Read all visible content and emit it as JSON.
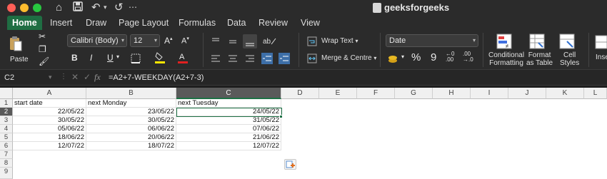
{
  "window": {
    "title": "geeksforgeeks"
  },
  "ribbon_tabs": [
    "Home",
    "Insert",
    "Draw",
    "Page Layout",
    "Formulas",
    "Data",
    "Review",
    "View"
  ],
  "ribbon": {
    "paste_label": "Paste",
    "font_name": "Calibri (Body)",
    "font_size": "12",
    "bold": "B",
    "italic": "I",
    "underline": "U",
    "wrap_text": "Wrap Text",
    "merge_centre": "Merge & Centre",
    "number_format": "Date",
    "percent": "%",
    "comma": "9",
    "conditional_formatting_1": "Conditional",
    "conditional_formatting_2": "Formatting",
    "format_as_table_1": "Format",
    "format_as_table_2": "as Table",
    "cell_styles_1": "Cell",
    "cell_styles_2": "Styles",
    "insert_label": "Inse"
  },
  "formula_bar": {
    "name_box": "C2",
    "formula": "=A2+7-WEEKDAY(A2+7-3)"
  },
  "sheet": {
    "columns": [
      "A",
      "B",
      "C",
      "D",
      "E",
      "F",
      "G",
      "H",
      "I",
      "J",
      "K",
      "L"
    ],
    "rows": [
      "1",
      "2",
      "3",
      "4",
      "5",
      "6",
      "7",
      "8",
      "9"
    ],
    "headers": [
      "start date",
      "next Monday",
      "next Tuesday"
    ],
    "data": [
      [
        "22/05/22",
        "23/05/22",
        "24/05/22"
      ],
      [
        "30/05/22",
        "30/05/22",
        "31/05/22"
      ],
      [
        "05/06/22",
        "06/06/22",
        "07/06/22"
      ],
      [
        "18/06/22",
        "20/06/22",
        "21/06/22"
      ],
      [
        "12/07/22",
        "18/07/22",
        "12/07/22"
      ]
    ],
    "selected_cell": "C2"
  },
  "colors": {
    "accent_green": "#1e7145",
    "tab_active": "#1f6e43"
  }
}
